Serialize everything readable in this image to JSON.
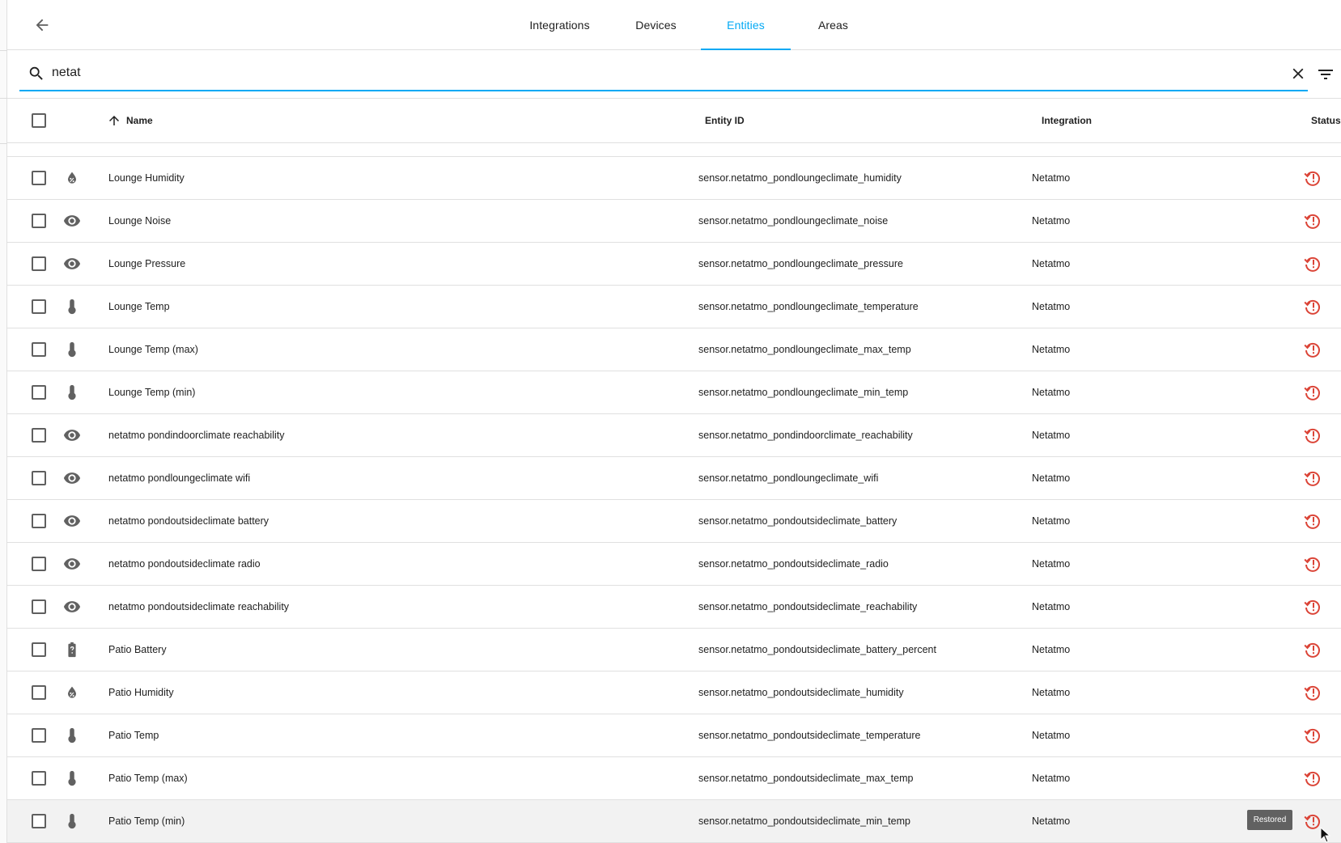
{
  "nav": {
    "tabs": [
      {
        "label": "Integrations",
        "active": false
      },
      {
        "label": "Devices",
        "active": false
      },
      {
        "label": "Entities",
        "active": true
      },
      {
        "label": "Areas",
        "active": false
      }
    ],
    "accent_color": "#03a9f4"
  },
  "search": {
    "value": "netat",
    "placeholder": "Search"
  },
  "table": {
    "columns": {
      "name": "Name",
      "entity_id": "Entity ID",
      "integration": "Integration",
      "status": "Status"
    },
    "sort": "ascending",
    "status_color": "#db4437",
    "rows": [
      {
        "icon": "water-percent-icon",
        "name": "Lounge Humidity",
        "entity_id": "sensor.netatmo_pondloungeclimate_humidity",
        "integration": "Netatmo",
        "status_icon": "restore-alert-icon"
      },
      {
        "icon": "eye-icon",
        "name": "Lounge Noise",
        "entity_id": "sensor.netatmo_pondloungeclimate_noise",
        "integration": "Netatmo",
        "status_icon": "restore-alert-icon"
      },
      {
        "icon": "eye-icon",
        "name": "Lounge Pressure",
        "entity_id": "sensor.netatmo_pondloungeclimate_pressure",
        "integration": "Netatmo",
        "status_icon": "restore-alert-icon"
      },
      {
        "icon": "thermometer-icon",
        "name": "Lounge Temp",
        "entity_id": "sensor.netatmo_pondloungeclimate_temperature",
        "integration": "Netatmo",
        "status_icon": "restore-alert-icon"
      },
      {
        "icon": "thermometer-icon",
        "name": "Lounge Temp (max)",
        "entity_id": "sensor.netatmo_pondloungeclimate_max_temp",
        "integration": "Netatmo",
        "status_icon": "restore-alert-icon"
      },
      {
        "icon": "thermometer-icon",
        "name": "Lounge Temp (min)",
        "entity_id": "sensor.netatmo_pondloungeclimate_min_temp",
        "integration": "Netatmo",
        "status_icon": "restore-alert-icon"
      },
      {
        "icon": "eye-icon",
        "name": "netatmo pondindoorclimate reachability",
        "entity_id": "sensor.netatmo_pondindoorclimate_reachability",
        "integration": "Netatmo",
        "status_icon": "restore-alert-icon"
      },
      {
        "icon": "eye-icon",
        "name": "netatmo pondloungeclimate wifi",
        "entity_id": "sensor.netatmo_pondloungeclimate_wifi",
        "integration": "Netatmo",
        "status_icon": "restore-alert-icon"
      },
      {
        "icon": "eye-icon",
        "name": "netatmo pondoutsideclimate battery",
        "entity_id": "sensor.netatmo_pondoutsideclimate_battery",
        "integration": "Netatmo",
        "status_icon": "restore-alert-icon"
      },
      {
        "icon": "eye-icon",
        "name": "netatmo pondoutsideclimate radio",
        "entity_id": "sensor.netatmo_pondoutsideclimate_radio",
        "integration": "Netatmo",
        "status_icon": "restore-alert-icon"
      },
      {
        "icon": "eye-icon",
        "name": "netatmo pondoutsideclimate reachability",
        "entity_id": "sensor.netatmo_pondoutsideclimate_reachability",
        "integration": "Netatmo",
        "status_icon": "restore-alert-icon"
      },
      {
        "icon": "battery-unknown-icon",
        "name": "Patio Battery",
        "entity_id": "sensor.netatmo_pondoutsideclimate_battery_percent",
        "integration": "Netatmo",
        "status_icon": "restore-alert-icon"
      },
      {
        "icon": "water-percent-icon",
        "name": "Patio Humidity",
        "entity_id": "sensor.netatmo_pondoutsideclimate_humidity",
        "integration": "Netatmo",
        "status_icon": "restore-alert-icon"
      },
      {
        "icon": "thermometer-icon",
        "name": "Patio Temp",
        "entity_id": "sensor.netatmo_pondoutsideclimate_temperature",
        "integration": "Netatmo",
        "status_icon": "restore-alert-icon"
      },
      {
        "icon": "thermometer-icon",
        "name": "Patio Temp (max)",
        "entity_id": "sensor.netatmo_pondoutsideclimate_max_temp",
        "integration": "Netatmo",
        "status_icon": "restore-alert-icon"
      },
      {
        "icon": "thermometer-icon",
        "name": "Patio Temp (min)",
        "entity_id": "sensor.netatmo_pondoutsideclimate_min_temp",
        "integration": "Netatmo",
        "status_icon": "restore-alert-icon",
        "hovered": true
      }
    ]
  },
  "tooltip": {
    "text": "Restored"
  }
}
